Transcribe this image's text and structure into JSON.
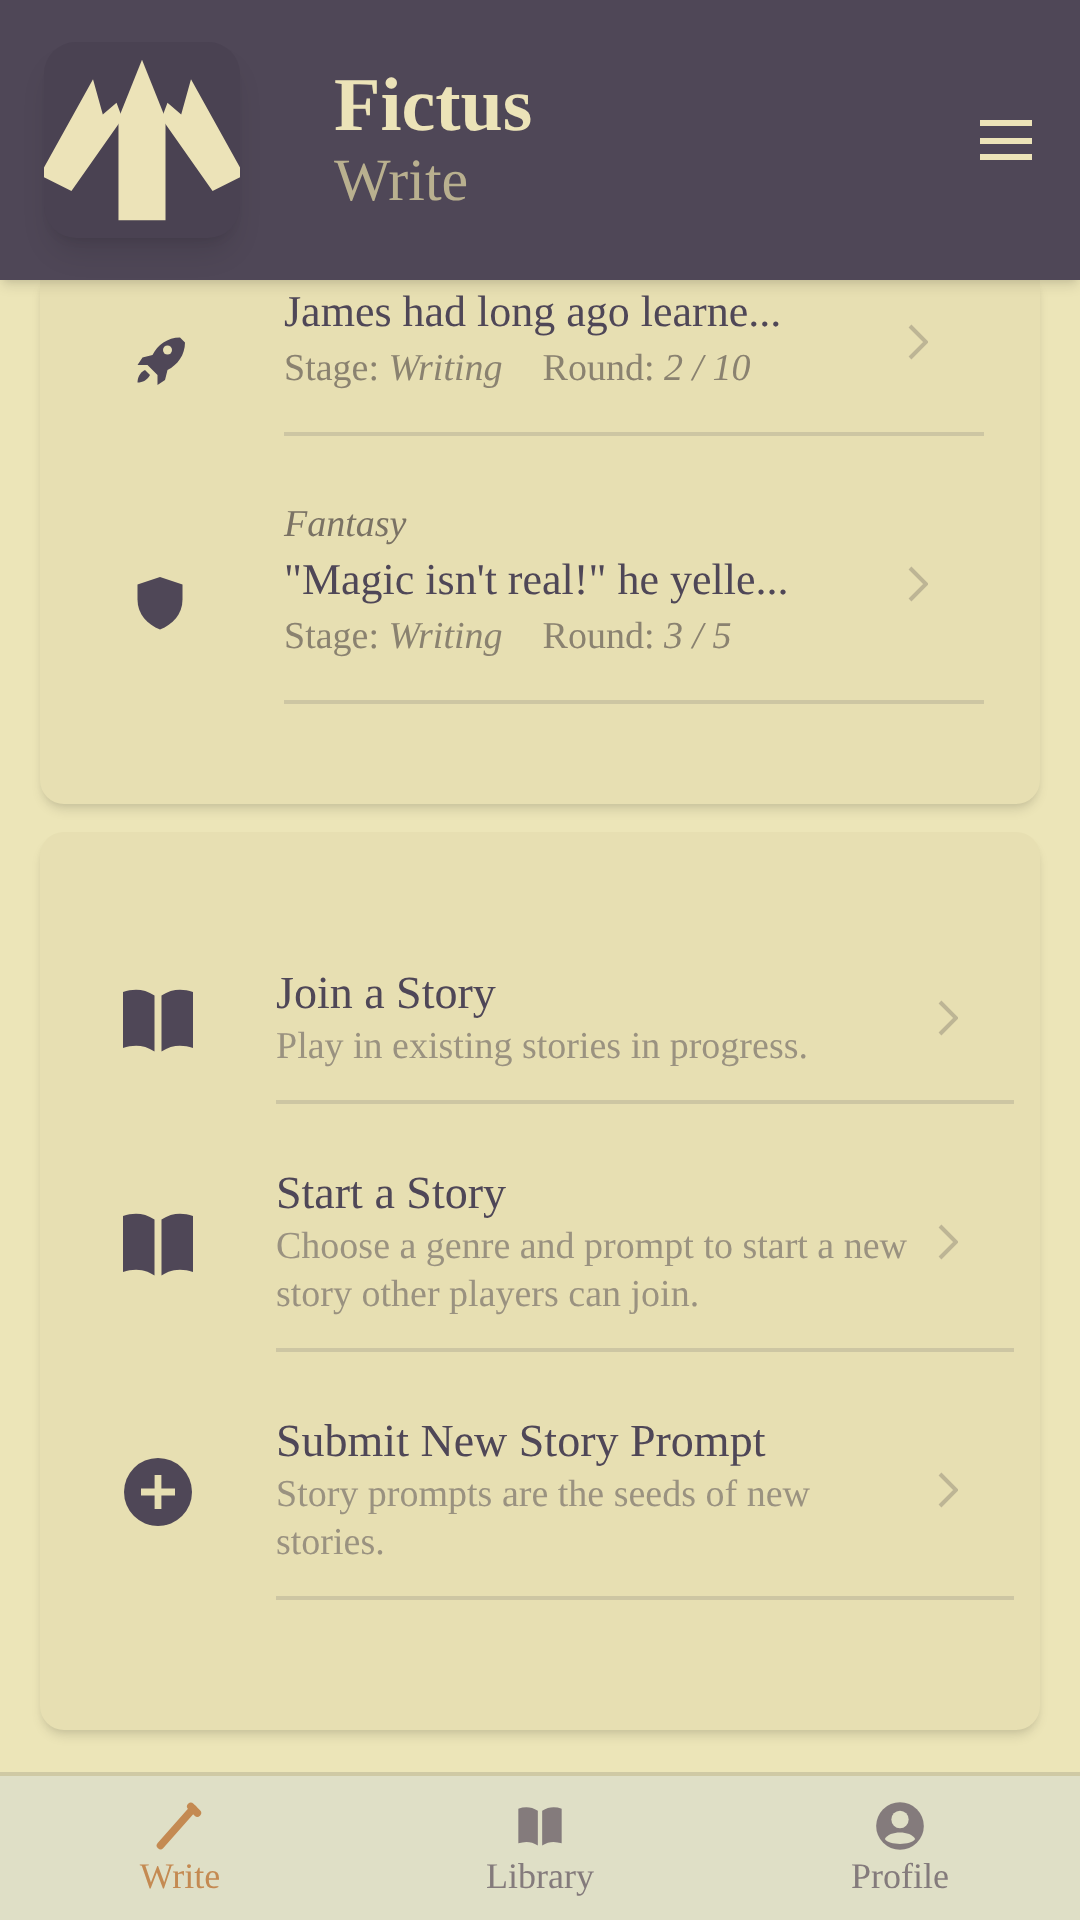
{
  "header": {
    "app_name": "Fictus",
    "section": "Write"
  },
  "stories": [
    {
      "kind": "rocket",
      "title": "James had long ago learne...",
      "stage_label": "Stage:",
      "stage": "Writing",
      "round_label": "Round:",
      "round": "2 / 10"
    },
    {
      "kind": "shield",
      "genre": "Fantasy",
      "title": "\"Magic isn't real!\" he yelle...",
      "stage_label": "Stage:",
      "stage": "Writing",
      "round_label": "Round:",
      "round": "3 / 5"
    }
  ],
  "actions": [
    {
      "kind": "book",
      "title": "Join a Story",
      "description": "Play in existing stories in progress."
    },
    {
      "kind": "book",
      "title": "Start a Story",
      "description": "Choose a genre and prompt to start a new story other players can join."
    },
    {
      "kind": "plus",
      "title": "Submit New Story Prompt",
      "description": "Story prompts are the seeds of new stories."
    }
  ],
  "nav": [
    {
      "kind": "pencil",
      "label": "Write",
      "selected": true
    },
    {
      "kind": "book",
      "label": "Library",
      "selected": false
    },
    {
      "kind": "user",
      "label": "Profile",
      "selected": false
    }
  ]
}
